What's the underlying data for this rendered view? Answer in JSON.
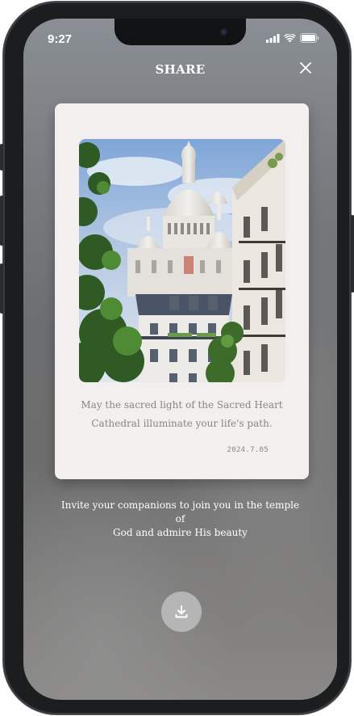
{
  "status_bar": {
    "time": "9:27",
    "icons": [
      "signal-icon",
      "wifi-icon",
      "battery-icon"
    ]
  },
  "header": {
    "title": "SHARE",
    "close_icon": "close-icon"
  },
  "card": {
    "image_alt": "Sacred Heart Cathedral, Montmartre",
    "caption_line1": "May the sacred light of the Sacred Heart",
    "caption_line2": "Cathedral illuminate your life's path.",
    "date": "2024.7.05"
  },
  "invite": {
    "line1": "Invite your companions to join you in the temple of",
    "line2": "God and admire His beauty"
  },
  "actions": {
    "download_icon": "download-icon"
  },
  "colors": {
    "card_bg": "#f3efee",
    "caption_text": "#8a8580",
    "button_bg": "#bebebe"
  }
}
